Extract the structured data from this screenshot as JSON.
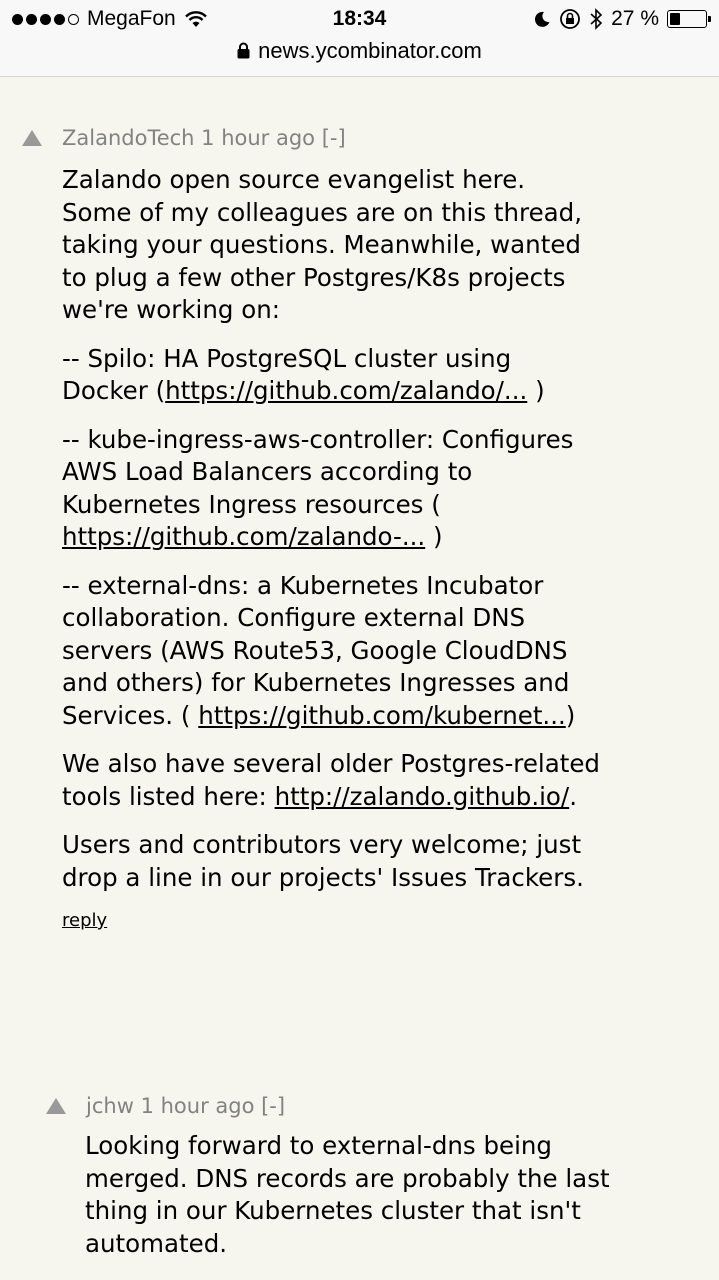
{
  "status_bar": {
    "carrier": "MegaFon",
    "time": "18:34",
    "battery": "27 %",
    "battery_level": 0.27
  },
  "browser": {
    "url": "news.ycombinator.com"
  },
  "comments": [
    {
      "user": "ZalandoTech",
      "age": "1 hour ago",
      "toggle": "[-]",
      "p1": "Zalando open source evangelist here. Some of my colleagues are on this thread, taking your questions. Meanwhile, wanted to plug a few other Postgres/K8s projects we're working on:",
      "p2_text": "-- Spilo: HA PostgreSQL cluster using Docker (",
      "p2_link": "https://github.com/zalando/...",
      "p2_end": " )",
      "p3_text": "-- kube-ingress-aws-controller: Configures AWS Load Balancers according to Kubernetes Ingress resources ( ",
      "p3_link": "https://github.com/zalando-...",
      "p3_end": " )",
      "p4_text": "-- external-dns: a Kubernetes Incubator collaboration. Configure external DNS servers (AWS Route53, Google CloudDNS and others) for Kubernetes Ingresses and Services. ( ",
      "p4_link": "https://github.com/kubernet...",
      "p4_end": ")",
      "p5_text": "We also have several older Postgres-related tools listed here: ",
      "p5_link": "http://zalando.github.io/",
      "p5_end": ".",
      "p6": "Users and contributors very welcome; just drop a line in our projects' Issues Trackers.",
      "reply": "reply"
    },
    {
      "user": "jchw",
      "age": "1 hour ago",
      "toggle": "[-]",
      "p1": "Looking forward to external-dns being merged. DNS records are probably the last thing in our Kubernetes cluster that isn't automated."
    }
  ]
}
